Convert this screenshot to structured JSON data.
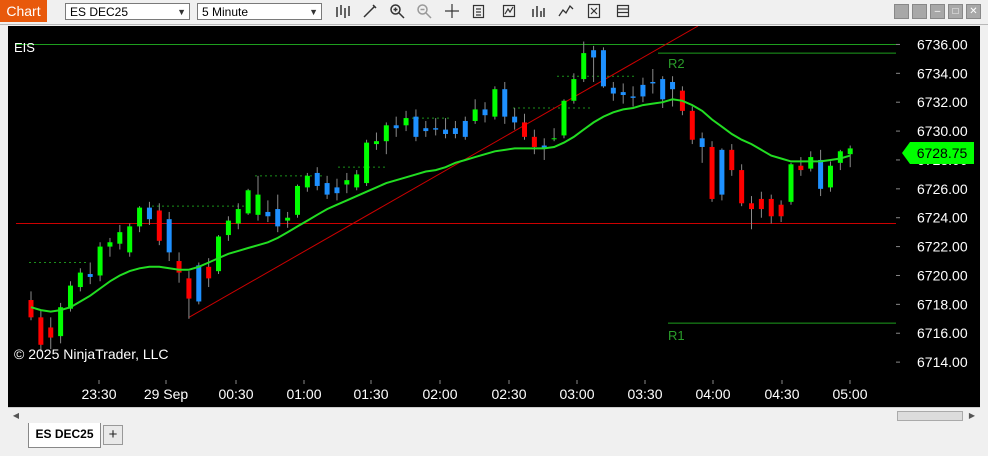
{
  "window": {
    "title": "Chart",
    "instrument": "ES DEC25",
    "interval": "5 Minute",
    "tab_label": "ES DEC25",
    "add_tab_label": "+"
  },
  "toolbar": {
    "icons": [
      "bars-type-icon",
      "draw-tool-icon",
      "zoom-in-icon",
      "zoom-out-icon",
      "crosshair-icon",
      "data-box-icon",
      "indicators-icon",
      "strategies-icon",
      "drawing-tools-icon",
      "properties-icon",
      "templates-icon"
    ]
  },
  "chart": {
    "series_label": "EIS",
    "copyright": "© 2025 NinjaTrader, LLC",
    "last_price": "6728.75",
    "level_labels": {
      "upper": "R2",
      "lower": "R1"
    },
    "colors": {
      "up": "#00ff00",
      "down": "#ff0000",
      "up_inside": "#1e90ff",
      "ma": "#22dd22",
      "lines": "#cc0000",
      "levels": "#2a9d2a",
      "background": "#000000",
      "axis_text": "#ffffff"
    }
  },
  "chart_data": {
    "type": "candlestick",
    "y_ticks": [
      "6736.00",
      "6734.00",
      "6732.00",
      "6730.00",
      "6728.00",
      "6726.00",
      "6724.00",
      "6722.00",
      "6720.00",
      "6718.00",
      "6716.00",
      "6714.00"
    ],
    "ylim": [
      6712.9,
      6737.0
    ],
    "x_ticks": [
      "23:30",
      "29 Sep",
      "00:30",
      "01:00",
      "01:30",
      "02:00",
      "02:30",
      "03:00",
      "03:30",
      "04:00",
      "04:30",
      "05:00"
    ],
    "horizontal_levels": [
      {
        "label": "",
        "value": 6736.0
      },
      {
        "label": "R2",
        "value": 6735.4
      },
      {
        "label": "",
        "value": 6723.6
      },
      {
        "label": "R1",
        "value": 6716.7
      }
    ],
    "candles": [
      {
        "o": 6718.3,
        "h": 6718.9,
        "l": 6716.9,
        "c": 6717.1,
        "k": "down"
      },
      {
        "o": 6717.1,
        "h": 6717.6,
        "l": 6714.7,
        "c": 6715.2,
        "k": "down"
      },
      {
        "o": 6716.4,
        "h": 6717.1,
        "l": 6714.9,
        "c": 6715.7,
        "k": "down"
      },
      {
        "o": 6715.8,
        "h": 6718.1,
        "l": 6715.3,
        "c": 6717.8,
        "k": "up"
      },
      {
        "o": 6717.7,
        "h": 6719.6,
        "l": 6717.5,
        "c": 6719.3,
        "k": "up"
      },
      {
        "o": 6719.2,
        "h": 6720.5,
        "l": 6718.9,
        "c": 6720.2,
        "k": "up"
      },
      {
        "o": 6720.1,
        "h": 6720.9,
        "l": 6719.4,
        "c": 6719.9,
        "k": "inside"
      },
      {
        "o": 6720.0,
        "h": 6722.3,
        "l": 6719.6,
        "c": 6722.0,
        "k": "up"
      },
      {
        "o": 6722.0,
        "h": 6722.6,
        "l": 6721.3,
        "c": 6722.3,
        "k": "up"
      },
      {
        "o": 6722.2,
        "h": 6723.5,
        "l": 6721.8,
        "c": 6723.0,
        "k": "up"
      },
      {
        "o": 6721.6,
        "h": 6723.6,
        "l": 6721.3,
        "c": 6723.4,
        "k": "up"
      },
      {
        "o": 6723.4,
        "h": 6724.8,
        "l": 6723.0,
        "c": 6724.7,
        "k": "up"
      },
      {
        "o": 6724.7,
        "h": 6725.1,
        "l": 6723.5,
        "c": 6723.9,
        "k": "inside"
      },
      {
        "o": 6724.5,
        "h": 6725.0,
        "l": 6722.1,
        "c": 6722.4,
        "k": "down"
      },
      {
        "o": 6723.9,
        "h": 6724.4,
        "l": 6721.0,
        "c": 6721.6,
        "k": "inside"
      },
      {
        "o": 6721.0,
        "h": 6721.6,
        "l": 6719.5,
        "c": 6720.2,
        "k": "down"
      },
      {
        "o": 6719.8,
        "h": 6720.3,
        "l": 6717.0,
        "c": 6718.4,
        "k": "down"
      },
      {
        "o": 6718.2,
        "h": 6720.9,
        "l": 6718.0,
        "c": 6720.7,
        "k": "inside"
      },
      {
        "o": 6720.6,
        "h": 6721.2,
        "l": 6719.2,
        "c": 6719.8,
        "k": "down"
      },
      {
        "o": 6720.3,
        "h": 6722.8,
        "l": 6720.1,
        "c": 6722.7,
        "k": "up"
      },
      {
        "o": 6722.8,
        "h": 6724.1,
        "l": 6722.4,
        "c": 6723.8,
        "k": "up"
      },
      {
        "o": 6723.6,
        "h": 6725.0,
        "l": 6723.2,
        "c": 6724.6,
        "k": "up"
      },
      {
        "o": 6724.3,
        "h": 6726.0,
        "l": 6724.2,
        "c": 6725.9,
        "k": "up"
      },
      {
        "o": 6725.6,
        "h": 6726.9,
        "l": 6723.8,
        "c": 6724.2,
        "k": "up"
      },
      {
        "o": 6724.4,
        "h": 6725.2,
        "l": 6723.7,
        "c": 6724.1,
        "k": "inside"
      },
      {
        "o": 6724.6,
        "h": 6725.6,
        "l": 6723.0,
        "c": 6723.4,
        "k": "inside"
      },
      {
        "o": 6723.8,
        "h": 6724.4,
        "l": 6723.3,
        "c": 6724.0,
        "k": "up"
      },
      {
        "o": 6724.2,
        "h": 6726.3,
        "l": 6724.0,
        "c": 6726.2,
        "k": "up"
      },
      {
        "o": 6726.1,
        "h": 6727.1,
        "l": 6725.8,
        "c": 6726.9,
        "k": "up"
      },
      {
        "o": 6727.1,
        "h": 6727.5,
        "l": 6725.9,
        "c": 6726.2,
        "k": "inside"
      },
      {
        "o": 6726.4,
        "h": 6726.9,
        "l": 6725.3,
        "c": 6725.6,
        "k": "inside"
      },
      {
        "o": 6725.7,
        "h": 6726.7,
        "l": 6725.2,
        "c": 6726.1,
        "k": "inside"
      },
      {
        "o": 6726.3,
        "h": 6727.1,
        "l": 6725.7,
        "c": 6726.6,
        "k": "up"
      },
      {
        "o": 6726.1,
        "h": 6727.3,
        "l": 6725.9,
        "c": 6727.0,
        "k": "up"
      },
      {
        "o": 6726.4,
        "h": 6729.4,
        "l": 6726.2,
        "c": 6729.2,
        "k": "up"
      },
      {
        "o": 6729.1,
        "h": 6729.9,
        "l": 6728.7,
        "c": 6729.3,
        "k": "up"
      },
      {
        "o": 6729.3,
        "h": 6730.6,
        "l": 6728.4,
        "c": 6730.4,
        "k": "up"
      },
      {
        "o": 6730.2,
        "h": 6731.0,
        "l": 6729.6,
        "c": 6730.4,
        "k": "inside"
      },
      {
        "o": 6730.4,
        "h": 6731.4,
        "l": 6730.0,
        "c": 6730.9,
        "k": "up"
      },
      {
        "o": 6731.0,
        "h": 6731.5,
        "l": 6729.3,
        "c": 6729.6,
        "k": "inside"
      },
      {
        "o": 6730.0,
        "h": 6730.7,
        "l": 6729.6,
        "c": 6730.2,
        "k": "inside"
      },
      {
        "o": 6730.2,
        "h": 6730.9,
        "l": 6729.7,
        "c": 6730.1,
        "k": "inside"
      },
      {
        "o": 6730.1,
        "h": 6730.9,
        "l": 6729.5,
        "c": 6729.8,
        "k": "inside"
      },
      {
        "o": 6729.8,
        "h": 6730.7,
        "l": 6729.5,
        "c": 6730.2,
        "k": "inside"
      },
      {
        "o": 6729.6,
        "h": 6731.0,
        "l": 6729.4,
        "c": 6730.7,
        "k": "inside"
      },
      {
        "o": 6730.7,
        "h": 6732.2,
        "l": 6730.5,
        "c": 6731.5,
        "k": "up"
      },
      {
        "o": 6731.5,
        "h": 6732.0,
        "l": 6730.6,
        "c": 6731.1,
        "k": "inside"
      },
      {
        "o": 6731.0,
        "h": 6733.1,
        "l": 6730.8,
        "c": 6732.9,
        "k": "up"
      },
      {
        "o": 6732.9,
        "h": 6733.4,
        "l": 6730.5,
        "c": 6731.0,
        "k": "inside"
      },
      {
        "o": 6731.0,
        "h": 6731.6,
        "l": 6730.1,
        "c": 6730.6,
        "k": "inside"
      },
      {
        "o": 6730.6,
        "h": 6731.2,
        "l": 6729.4,
        "c": 6729.6,
        "k": "down"
      },
      {
        "o": 6729.6,
        "h": 6730.1,
        "l": 6728.4,
        "c": 6728.9,
        "k": "down"
      },
      {
        "o": 6729.0,
        "h": 6729.5,
        "l": 6728.0,
        "c": 6728.8,
        "k": "inside"
      },
      {
        "o": 6729.5,
        "h": 6730.2,
        "l": 6729.3,
        "c": 6729.5,
        "k": "up"
      },
      {
        "o": 6729.7,
        "h": 6732.2,
        "l": 6729.5,
        "c": 6732.1,
        "k": "up"
      },
      {
        "o": 6732.1,
        "h": 6734.0,
        "l": 6731.9,
        "c": 6733.6,
        "k": "up"
      },
      {
        "o": 6733.6,
        "h": 6736.2,
        "l": 6733.4,
        "c": 6735.4,
        "k": "up"
      },
      {
        "o": 6735.6,
        "h": 6735.9,
        "l": 6733.4,
        "c": 6735.1,
        "k": "inside"
      },
      {
        "o": 6735.6,
        "h": 6735.8,
        "l": 6733.0,
        "c": 6733.1,
        "k": "inside"
      },
      {
        "o": 6733.0,
        "h": 6733.4,
        "l": 6732.1,
        "c": 6732.6,
        "k": "inside"
      },
      {
        "o": 6732.7,
        "h": 6733.3,
        "l": 6731.9,
        "c": 6732.5,
        "k": "inside"
      },
      {
        "o": 6732.4,
        "h": 6733.1,
        "l": 6731.7,
        "c": 6732.3,
        "k": "inside"
      },
      {
        "o": 6732.4,
        "h": 6733.7,
        "l": 6732.0,
        "c": 6733.2,
        "k": "inside"
      },
      {
        "o": 6733.3,
        "h": 6734.3,
        "l": 6732.6,
        "c": 6733.4,
        "k": "inside"
      },
      {
        "o": 6733.6,
        "h": 6733.8,
        "l": 6731.6,
        "c": 6732.2,
        "k": "inside"
      },
      {
        "o": 6733.4,
        "h": 6733.8,
        "l": 6731.7,
        "c": 6732.9,
        "k": "inside"
      },
      {
        "o": 6732.8,
        "h": 6733.1,
        "l": 6731.1,
        "c": 6731.4,
        "k": "down"
      },
      {
        "o": 6731.4,
        "h": 6731.7,
        "l": 6729.1,
        "c": 6729.4,
        "k": "down"
      },
      {
        "o": 6729.5,
        "h": 6729.9,
        "l": 6727.8,
        "c": 6728.9,
        "k": "inside"
      },
      {
        "o": 6728.9,
        "h": 6729.3,
        "l": 6725.1,
        "c": 6725.3,
        "k": "down"
      },
      {
        "o": 6725.6,
        "h": 6728.8,
        "l": 6725.2,
        "c": 6728.7,
        "k": "inside"
      },
      {
        "o": 6728.7,
        "h": 6729.1,
        "l": 6726.9,
        "c": 6727.3,
        "k": "down"
      },
      {
        "o": 6727.3,
        "h": 6727.7,
        "l": 6724.8,
        "c": 6725.0,
        "k": "down"
      },
      {
        "o": 6725.0,
        "h": 6725.5,
        "l": 6723.2,
        "c": 6724.6,
        "k": "down"
      },
      {
        "o": 6724.6,
        "h": 6725.8,
        "l": 6724.0,
        "c": 6725.3,
        "k": "down"
      },
      {
        "o": 6725.3,
        "h": 6725.6,
        "l": 6723.6,
        "c": 6724.1,
        "k": "down"
      },
      {
        "o": 6724.1,
        "h": 6725.2,
        "l": 6723.7,
        "c": 6724.9,
        "k": "down"
      },
      {
        "o": 6725.1,
        "h": 6727.8,
        "l": 6724.9,
        "c": 6727.7,
        "k": "up"
      },
      {
        "o": 6727.6,
        "h": 6728.2,
        "l": 6726.9,
        "c": 6727.3,
        "k": "down"
      },
      {
        "o": 6727.4,
        "h": 6728.6,
        "l": 6727.2,
        "c": 6728.2,
        "k": "up"
      },
      {
        "o": 6728.0,
        "h": 6728.7,
        "l": 6725.5,
        "c": 6726.0,
        "k": "inside"
      },
      {
        "o": 6726.1,
        "h": 6727.9,
        "l": 6725.8,
        "c": 6727.6,
        "k": "up"
      },
      {
        "o": 6727.8,
        "h": 6728.7,
        "l": 6727.3,
        "c": 6728.6,
        "k": "up"
      },
      {
        "o": 6728.4,
        "h": 6729.0,
        "l": 6727.5,
        "c": 6728.8,
        "k": "up"
      }
    ],
    "moving_average": [
      6717.8,
      6717.6,
      6717.5,
      6717.6,
      6717.8,
      6718.2,
      6718.6,
      6719.1,
      6719.6,
      6720.0,
      6720.3,
      6720.5,
      6720.6,
      6720.6,
      6720.5,
      6720.4,
      6720.4,
      6720.6,
      6720.9,
      6721.2,
      6721.5,
      6721.7,
      6721.9,
      6722.1,
      6722.3,
      6722.6,
      6723.0,
      6723.4,
      6723.8,
      6724.2,
      6724.6,
      6724.9,
      6725.2,
      6725.5,
      6725.8,
      6726.1,
      6726.4,
      6726.6,
      6726.8,
      6727.0,
      6727.2,
      6727.3,
      6727.5,
      6727.8,
      6728.0,
      6728.2,
      6728.4,
      6728.6,
      6728.7,
      6728.8,
      6728.8,
      6728.8,
      6728.8,
      6728.9,
      6729.2,
      6729.6,
      6730.1,
      6730.6,
      6731.0,
      6731.3,
      6731.5,
      6731.6,
      6731.8,
      6731.9,
      6732.0,
      6732.2,
      6732.1,
      6731.8,
      6731.4,
      6730.8,
      6730.3,
      6729.8,
      6729.4,
      6729.1,
      6728.7,
      6728.3,
      6728.1,
      6727.9,
      6727.9,
      6727.9,
      6727.9,
      6728.0,
      6728.1,
      6728.3
    ]
  }
}
